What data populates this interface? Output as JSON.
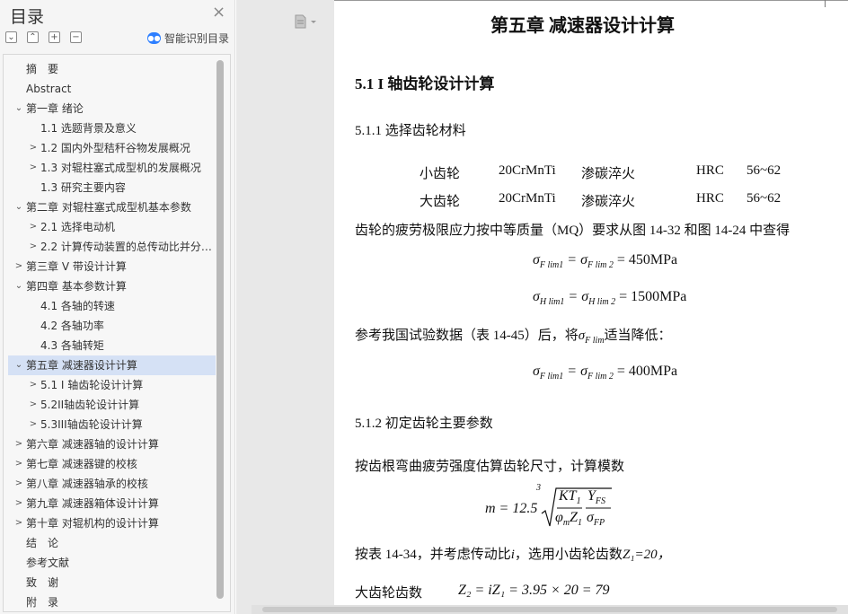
{
  "sidebar": {
    "title": "目录",
    "close_glyph": "×",
    "toolbar": [
      "⌄",
      "⌃",
      "+",
      "−"
    ],
    "smart_toc_label": "智能识别目录",
    "items": [
      {
        "label": "摘　要",
        "arrow": "",
        "level": 0
      },
      {
        "label": "Abstract",
        "arrow": "",
        "level": 0
      },
      {
        "label": "第一章  绪论",
        "arrow": "⌄",
        "level": 0
      },
      {
        "label": "1.1 选题背景及意义",
        "arrow": "",
        "level": 1
      },
      {
        "label": "1.2 国内外型秸秆谷物发展概况",
        "arrow": ">",
        "level": 1
      },
      {
        "label": "1.3 对辊柱塞式成型机的发展概况",
        "arrow": ">",
        "level": 1
      },
      {
        "label": "1.3 研究主要内容",
        "arrow": "",
        "level": 1
      },
      {
        "label": "第二章  对辊柱塞式成型机基本参数",
        "arrow": "⌄",
        "level": 0
      },
      {
        "label": "2.1 选择电动机",
        "arrow": ">",
        "level": 1
      },
      {
        "label": "2.2 计算传动装置的总传动比并分…",
        "arrow": ">",
        "level": 1
      },
      {
        "label": "第三章  V 带设计计算",
        "arrow": ">",
        "level": 0
      },
      {
        "label": "第四章  基本参数计算",
        "arrow": "⌄",
        "level": 0
      },
      {
        "label": "4.1 各轴的转速",
        "arrow": "",
        "level": 1
      },
      {
        "label": "4.2 各轴功率",
        "arrow": "",
        "level": 1
      },
      {
        "label": "4.3 各轴转矩",
        "arrow": "",
        "level": 1
      },
      {
        "label": "第五章  减速器设计计算",
        "arrow": "⌄",
        "level": 0,
        "selected": true
      },
      {
        "label": "5.1 I 轴齿轮设计计算",
        "arrow": ">",
        "level": 1
      },
      {
        "label": "5.2II轴齿轮设计计算",
        "arrow": ">",
        "level": 1
      },
      {
        "label": "5.3III轴齿轮设计计算",
        "arrow": ">",
        "level": 1
      },
      {
        "label": "第六章  减速器轴的设计计算",
        "arrow": ">",
        "level": 0
      },
      {
        "label": "第七章  减速器键的校核",
        "arrow": ">",
        "level": 0
      },
      {
        "label": "第八章  减速器轴承的校核",
        "arrow": ">",
        "level": 0
      },
      {
        "label": "第九章  减速器箱体设计计算",
        "arrow": ">",
        "level": 0
      },
      {
        "label": "第十章  对辊机构的设计计算",
        "arrow": ">",
        "level": 0
      },
      {
        "label": "结　论",
        "arrow": "",
        "level": 0
      },
      {
        "label": "参考文献",
        "arrow": "",
        "level": 0
      },
      {
        "label": "致　谢",
        "arrow": "",
        "level": 0
      },
      {
        "label": "附　录",
        "arrow": "",
        "level": 0
      }
    ]
  },
  "document": {
    "chapter_title": "第五章  减速器设计计算",
    "section_title": "5.1 I 轴齿轮设计计算",
    "sub1": "5.1.1 选择齿轮材料",
    "materials": [
      {
        "name": "小齿轮",
        "material": "20CrMnTi",
        "treatment": "渗碳淬火",
        "hardness_unit": "HRC",
        "hardness": "56~62"
      },
      {
        "name": "大齿轮",
        "material": "20CrMnTi",
        "treatment": "渗碳淬火",
        "hardness_unit": "HRC",
        "hardness": "56~62"
      }
    ],
    "para1": "齿轮的疲劳极限应力按中等质量（MQ）要求从图 14-32 和图 14-24 中查得",
    "eq1_value": "= 450MPa",
    "eq2_value": "= 1500MPa",
    "para2_prefix": "参考我国试验数据（表 14-45）后，将",
    "para2_suffix": "适当降低：",
    "eq3_value": "= 400MPa",
    "sub2": "5.1.2 初定齿轮主要参数",
    "para3": "按齿根弯曲疲劳强度估算齿轮尺寸，计算模数",
    "eq4_lhs": "m = 12.5",
    "eq4_root_index": "3",
    "para4_prefix": "按表 14-34，并考虑传动比",
    "para4_i": "i",
    "para4_mid": "，选用小齿轮齿数",
    "para4_z1": "Z₁=20，",
    "para5_label": "大齿轮齿数",
    "eq5": "Z₂ = iZ₁ = 3.95 × 20 = 79"
  }
}
